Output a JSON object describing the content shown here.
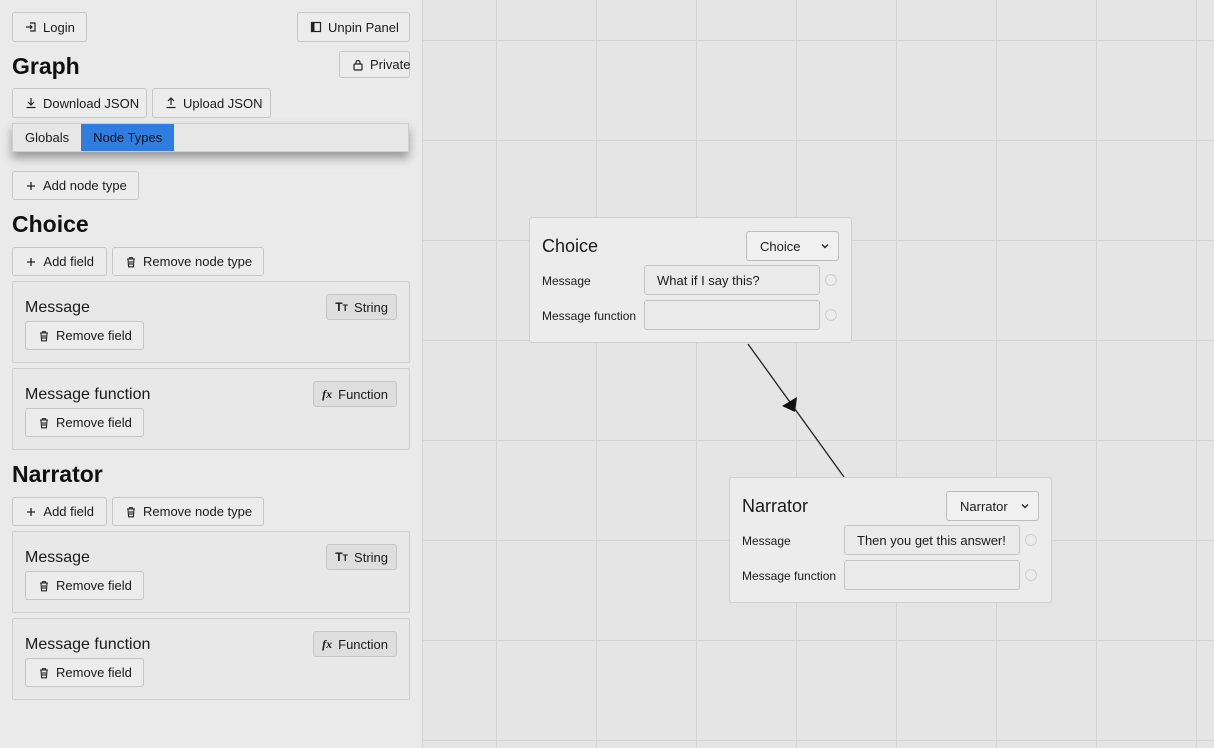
{
  "toolbar": {
    "login_label": "Login",
    "unpin_label": "Unpin Panel",
    "graph_title": "Graph",
    "private_label": "Private",
    "download_label": "Download JSON",
    "upload_label": "Upload JSON"
  },
  "tabs": [
    {
      "label": "Globals",
      "active": false
    },
    {
      "label": "Node Types",
      "active": true
    }
  ],
  "add_node_type_label": "Add node type",
  "node_types": [
    {
      "name": "Choice",
      "add_field_label": "Add field",
      "remove_node_type_label": "Remove node type",
      "fields": [
        {
          "name": "Message",
          "type": "String",
          "type_icon": "text-type-icon",
          "remove_label": "Remove field"
        },
        {
          "name": "Message function",
          "type": "Function",
          "type_icon": "function-icon",
          "remove_label": "Remove field"
        }
      ]
    },
    {
      "name": "Narrator",
      "add_field_label": "Add field",
      "remove_node_type_label": "Remove node type",
      "fields": [
        {
          "name": "Message",
          "type": "String",
          "type_icon": "text-type-icon",
          "remove_label": "Remove field"
        },
        {
          "name": "Message function",
          "type": "Function",
          "type_icon": "function-icon",
          "remove_label": "Remove field"
        }
      ]
    }
  ],
  "graph_nodes": [
    {
      "title": "Choice",
      "type_select": "Choice",
      "fields": [
        {
          "label": "Message",
          "value": "What if I say this?"
        },
        {
          "label": "Message function",
          "value": ""
        }
      ]
    },
    {
      "title": "Narrator",
      "type_select": "Narrator",
      "fields": [
        {
          "label": "Message",
          "value": "Then you get this answer!"
        },
        {
          "label": "Message function",
          "value": ""
        }
      ]
    }
  ],
  "colors": {
    "active_tab": "#2f7de1",
    "panel_bg": "#eaeaea",
    "canvas_bg": "#e5e5e5"
  }
}
